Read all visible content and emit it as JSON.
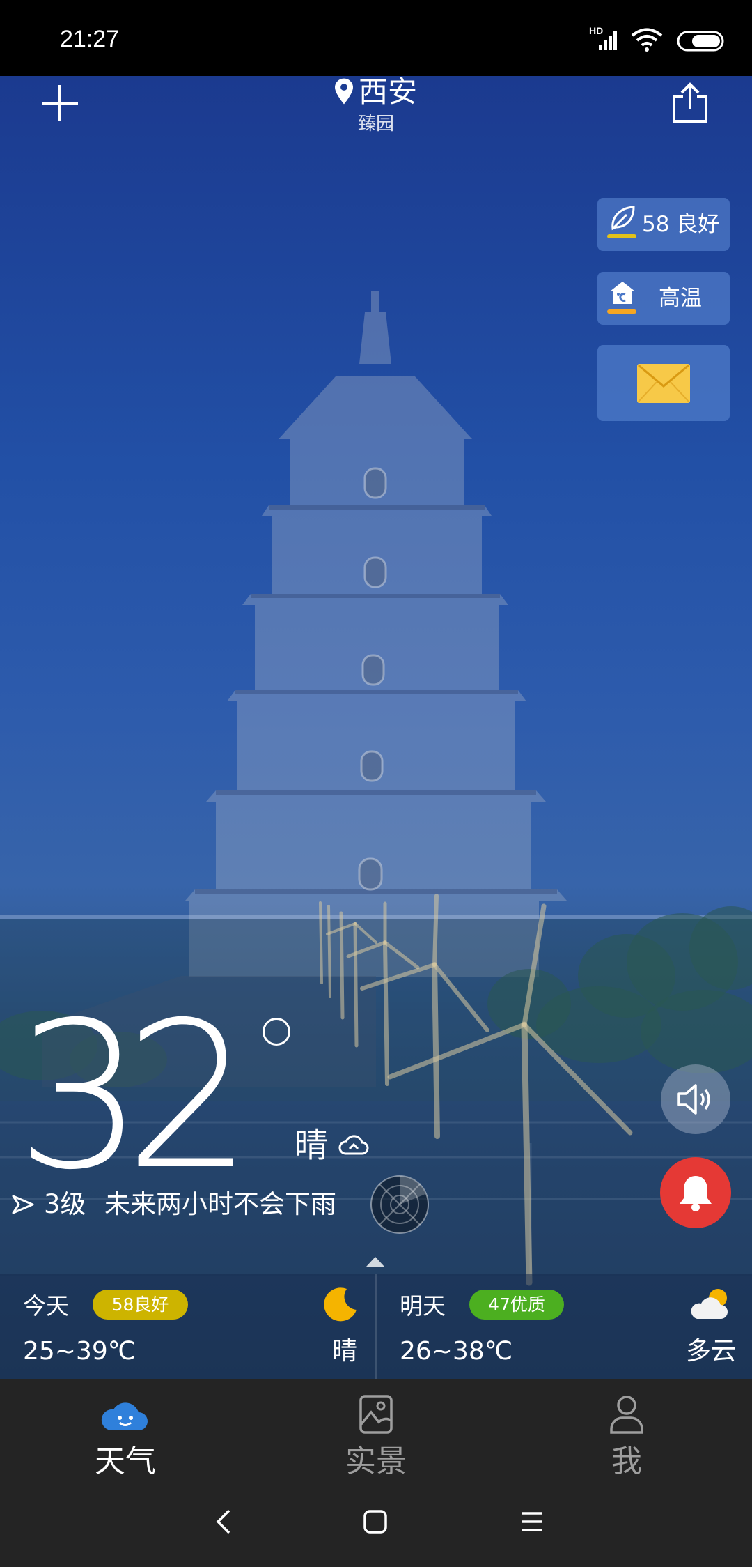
{
  "status_bar": {
    "time": "21:27",
    "network_label": "HD",
    "icons": [
      "signal-icon",
      "wifi-icon",
      "battery-icon"
    ]
  },
  "header": {
    "add_icon": "plus-icon",
    "location_icon": "location-pin-icon",
    "city": "西安",
    "district": "臻园",
    "share_icon": "share-icon"
  },
  "side_badges": {
    "air_quality": {
      "icon": "leaf-icon",
      "value": "58",
      "label": "良好",
      "color": "#e2c21a"
    },
    "warning": {
      "icon": "high-temperature-icon",
      "label": "高温",
      "color": "#f5a623"
    },
    "messages": {
      "icon": "envelope-icon",
      "color": "#f7c948"
    }
  },
  "current": {
    "temperature": "32",
    "condition": "晴",
    "condition_icon": "cloud-outline-icon",
    "wind_icon": "wind-direction-icon",
    "wind_level": "3级",
    "rain_forecast": "未来两小时不会下雨",
    "radar_icon": "radar-icon"
  },
  "actions": {
    "voice_icon": "speaker-icon",
    "alarm_icon": "bell-icon",
    "alarm_color": "#e53935",
    "expand_icon": "chevron-up-icon"
  },
  "forecast": [
    {
      "day": "今天",
      "aqi": "58良好",
      "aqi_color": "#cdb400",
      "temp_range": "25~39℃",
      "condition": "晴",
      "icon": "moon-icon"
    },
    {
      "day": "明天",
      "aqi": "47优质",
      "aqi_color": "#4caf20",
      "temp_range": "26~38℃",
      "condition": "多云",
      "icon": "partly-cloudy-icon"
    }
  ],
  "bottom_nav": [
    {
      "label": "天气",
      "icon": "weather-cloud-icon",
      "active": true
    },
    {
      "label": "实景",
      "icon": "photo-icon",
      "active": false
    },
    {
      "label": "我",
      "icon": "user-icon",
      "active": false
    }
  ],
  "system_nav": {
    "back_icon": "back-icon",
    "home_icon": "home-icon",
    "recents_icon": "menu-icon"
  }
}
